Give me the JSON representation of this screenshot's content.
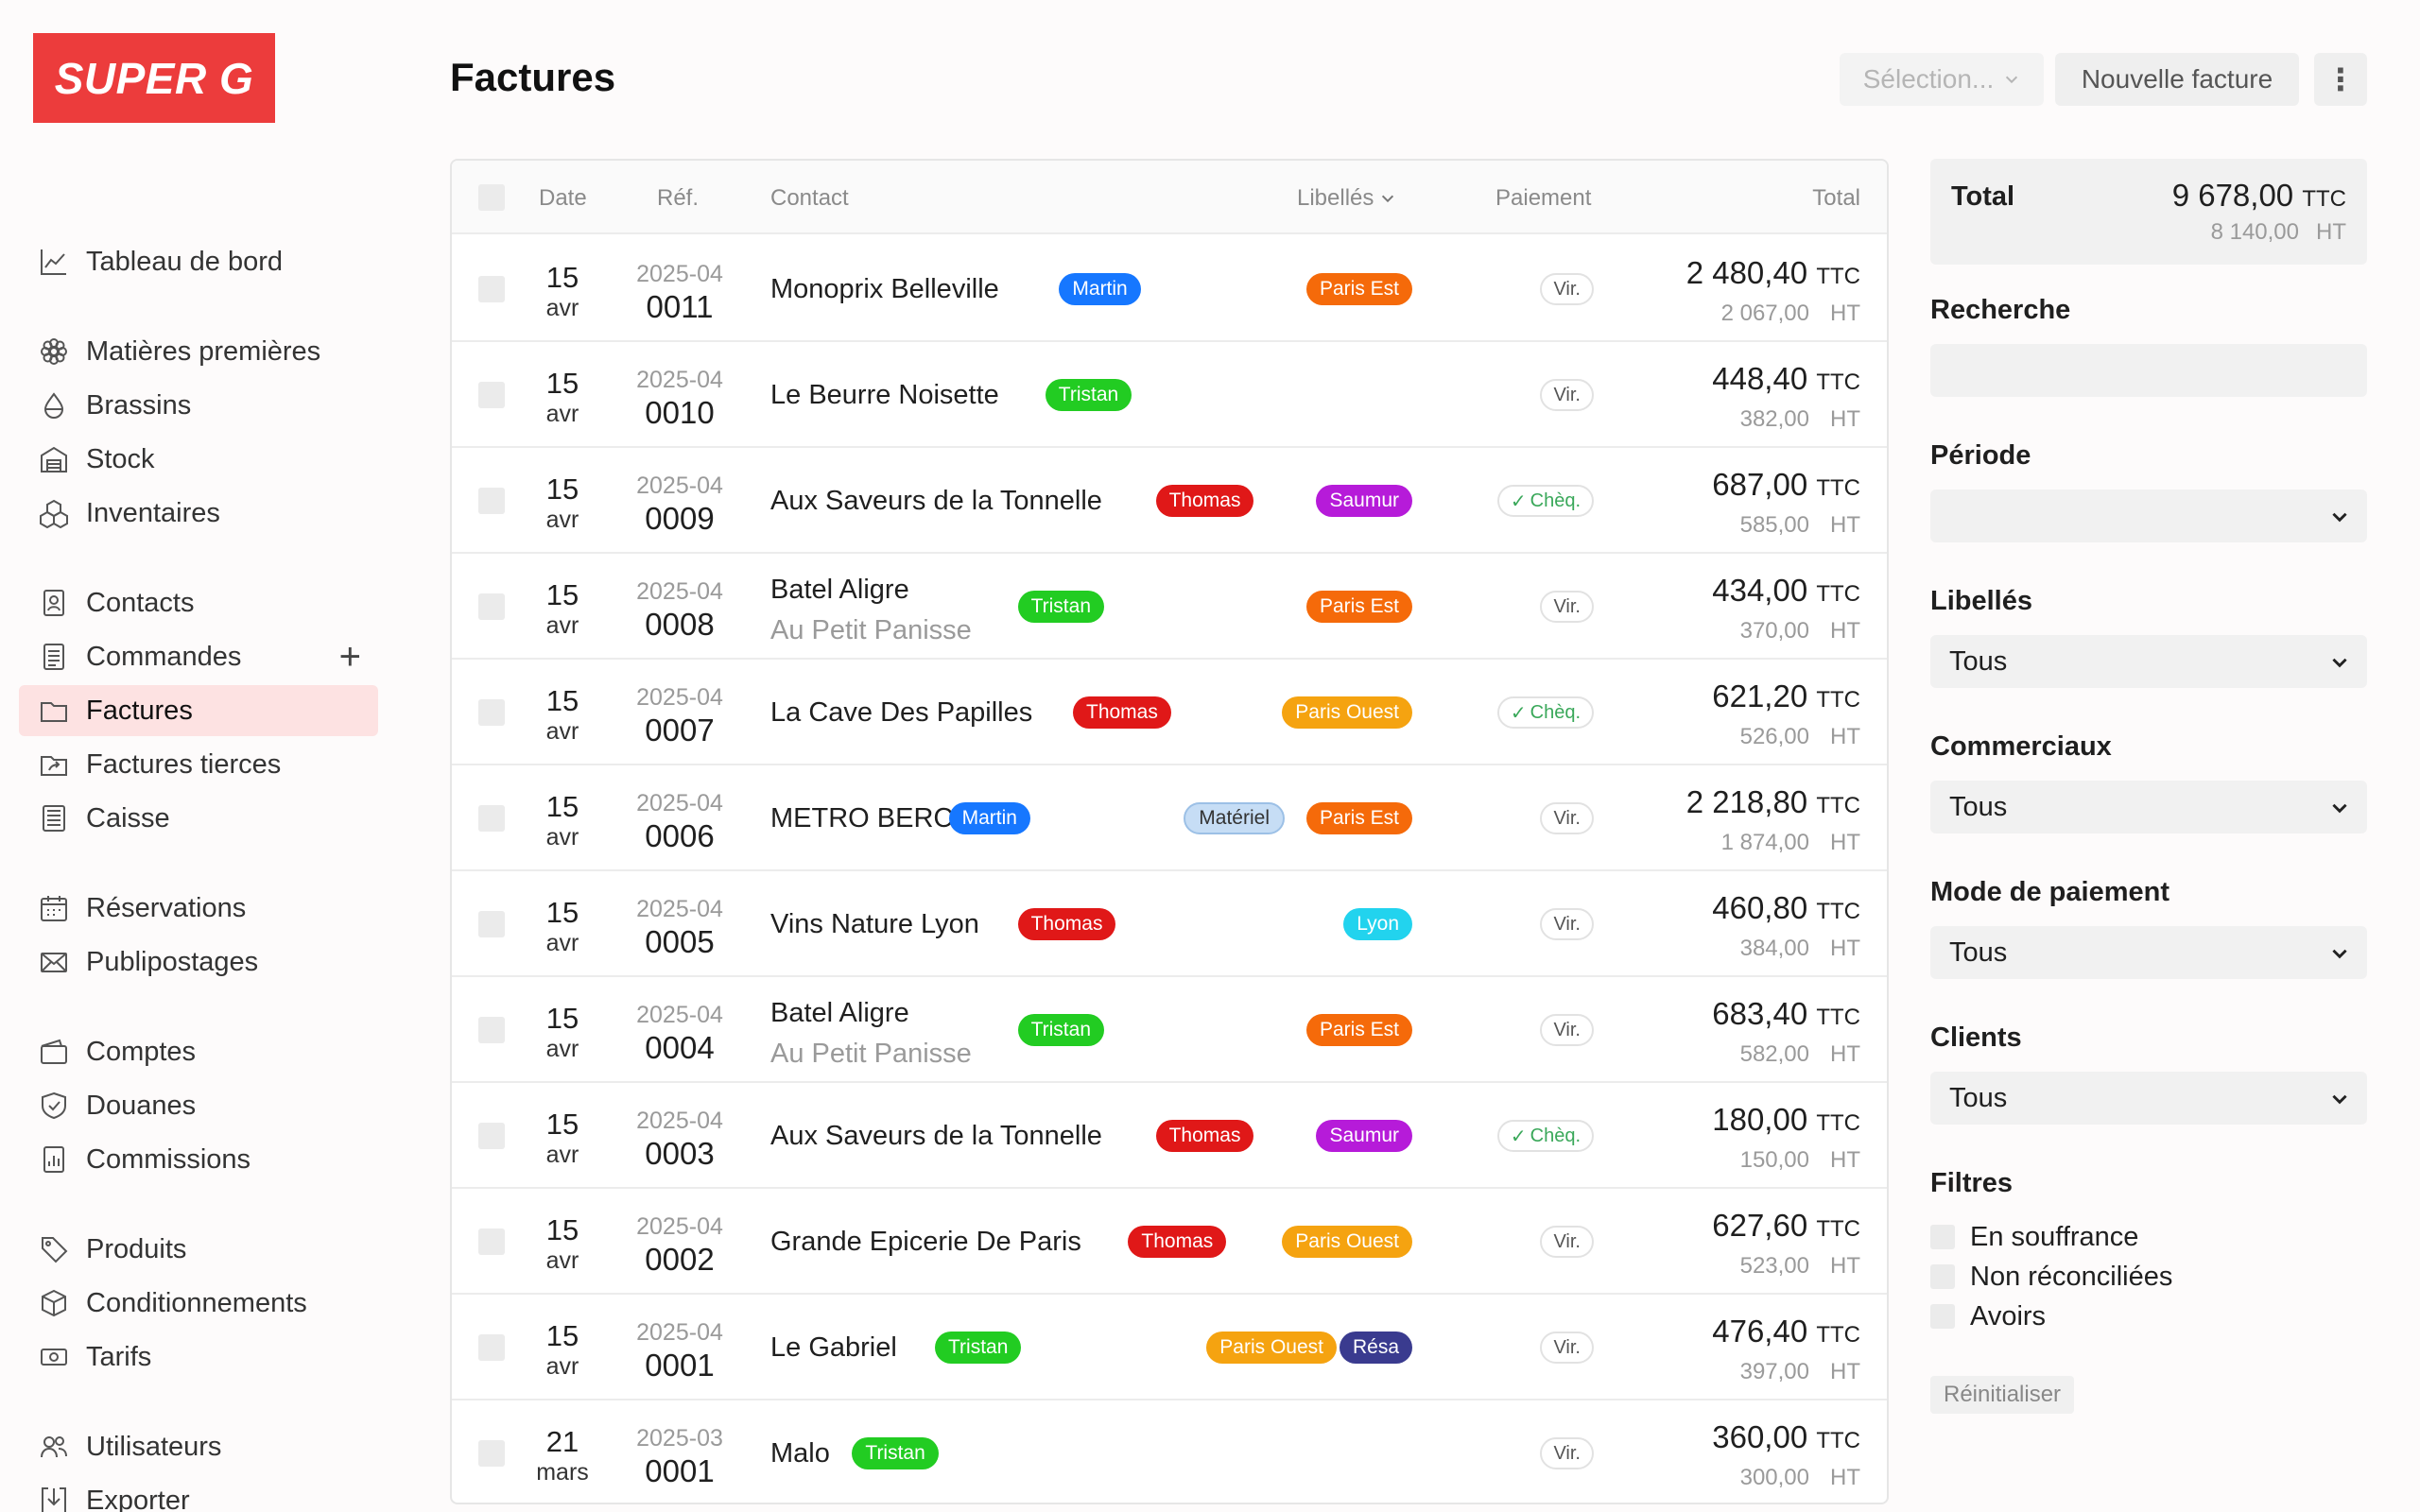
{
  "brand": {
    "logo_text": "SUPER G",
    "color": "#ec3c3c"
  },
  "sidebar": {
    "items": [
      {
        "label": "Tableau de bord",
        "icon": "chart-line-icon"
      },
      {
        "label": "Matières premières",
        "icon": "flower-icon"
      },
      {
        "label": "Brassins",
        "icon": "drop-icon"
      },
      {
        "label": "Stock",
        "icon": "warehouse-icon"
      },
      {
        "label": "Inventaires",
        "icon": "boxes-icon"
      },
      {
        "label": "Contacts",
        "icon": "contact-card-icon"
      },
      {
        "label": "Commandes",
        "icon": "receipt-list-icon"
      },
      {
        "label": "Factures",
        "icon": "folder-icon",
        "active": true
      },
      {
        "label": "Factures tierces",
        "icon": "folder-share-icon"
      },
      {
        "label": "Caisse",
        "icon": "register-icon"
      },
      {
        "label": "Réservations",
        "icon": "calendar-icon"
      },
      {
        "label": "Publipostages",
        "icon": "envelope-icon"
      },
      {
        "label": "Comptes",
        "icon": "wallet-icon"
      },
      {
        "label": "Douanes",
        "icon": "shield-check-icon"
      },
      {
        "label": "Commissions",
        "icon": "bar-report-icon"
      },
      {
        "label": "Produits",
        "icon": "tag-icon"
      },
      {
        "label": "Conditionnements",
        "icon": "package-icon"
      },
      {
        "label": "Tarifs",
        "icon": "banknote-icon"
      },
      {
        "label": "Utilisateurs",
        "icon": "users-icon"
      },
      {
        "label": "Exporter",
        "icon": "download-box-icon"
      }
    ],
    "add_symbol": "+"
  },
  "header": {
    "title": "Factures",
    "selection_label": "Sélection...",
    "new_invoice_label": "Nouvelle facture",
    "more_symbol": "⋮"
  },
  "table": {
    "columns": {
      "date": "Date",
      "ref": "Réf.",
      "contact": "Contact",
      "labels": "Libellés",
      "payment": "Paiement",
      "total": "Total"
    },
    "unit_ttc": "TTC",
    "unit_ht": "HT",
    "rows": [
      {
        "day": "15",
        "month": "avr",
        "ref_year": "2025-04",
        "ref_num": "0011",
        "contact": "Monoprix Belleville",
        "contact2": "",
        "seller": "Martin",
        "labels": [
          "Paris Est"
        ],
        "payment": "Vir.",
        "cheq": false,
        "ttc": "2 480,40",
        "ht": "2 067,00"
      },
      {
        "day": "15",
        "month": "avr",
        "ref_year": "2025-04",
        "ref_num": "0010",
        "contact": "Le Beurre Noisette",
        "contact2": "",
        "seller": "Tristan",
        "labels": [],
        "payment": "Vir.",
        "cheq": false,
        "ttc": "448,40",
        "ht": "382,00"
      },
      {
        "day": "15",
        "month": "avr",
        "ref_year": "2025-04",
        "ref_num": "0009",
        "contact": "Aux Saveurs de la Tonnelle",
        "contact2": "",
        "seller": "Thomas",
        "labels": [
          "Saumur"
        ],
        "payment": "Chèq.",
        "cheq": true,
        "ttc": "687,00",
        "ht": "585,00"
      },
      {
        "day": "15",
        "month": "avr",
        "ref_year": "2025-04",
        "ref_num": "0008",
        "contact": "Batel Aligre",
        "contact2": "Au Petit Panisse",
        "seller": "Tristan",
        "labels": [
          "Paris Est"
        ],
        "payment": "Vir.",
        "cheq": false,
        "ttc": "434,00",
        "ht": "370,00"
      },
      {
        "day": "15",
        "month": "avr",
        "ref_year": "2025-04",
        "ref_num": "0007",
        "contact": "La Cave Des Papilles",
        "contact2": "",
        "seller": "Thomas",
        "labels": [
          "Paris Ouest"
        ],
        "payment": "Chèq.",
        "cheq": true,
        "ttc": "621,20",
        "ht": "526,00"
      },
      {
        "day": "15",
        "month": "avr",
        "ref_year": "2025-04",
        "ref_num": "0006",
        "contact": "METRO BERCY",
        "contact2": "",
        "seller": "Martin",
        "labels": [
          "Matériel",
          "Paris Est"
        ],
        "payment": "Vir.",
        "cheq": false,
        "ttc": "2 218,80",
        "ht": "1 874,00"
      },
      {
        "day": "15",
        "month": "avr",
        "ref_year": "2025-04",
        "ref_num": "0005",
        "contact": "Vins Nature Lyon",
        "contact2": "",
        "seller": "Thomas",
        "labels": [
          "Lyon"
        ],
        "payment": "Vir.",
        "cheq": false,
        "ttc": "460,80",
        "ht": "384,00"
      },
      {
        "day": "15",
        "month": "avr",
        "ref_year": "2025-04",
        "ref_num": "0004",
        "contact": "Batel Aligre",
        "contact2": "Au Petit Panisse",
        "seller": "Tristan",
        "labels": [
          "Paris Est"
        ],
        "payment": "Vir.",
        "cheq": false,
        "ttc": "683,40",
        "ht": "582,00"
      },
      {
        "day": "15",
        "month": "avr",
        "ref_year": "2025-04",
        "ref_num": "0003",
        "contact": "Aux Saveurs de la Tonnelle",
        "contact2": "",
        "seller": "Thomas",
        "labels": [
          "Saumur"
        ],
        "payment": "Chèq.",
        "cheq": true,
        "ttc": "180,00",
        "ht": "150,00"
      },
      {
        "day": "15",
        "month": "avr",
        "ref_year": "2025-04",
        "ref_num": "0002",
        "contact": "Grande Epicerie De Paris",
        "contact2": "",
        "seller": "Thomas",
        "labels": [
          "Paris Ouest"
        ],
        "payment": "Vir.",
        "cheq": false,
        "ttc": "627,60",
        "ht": "523,00"
      },
      {
        "day": "15",
        "month": "avr",
        "ref_year": "2025-04",
        "ref_num": "0001",
        "contact": "Le Gabriel",
        "contact2": "",
        "seller": "Tristan",
        "labels": [
          "Paris Ouest",
          "Résa"
        ],
        "payment": "Vir.",
        "cheq": false,
        "ttc": "476,40",
        "ht": "397,00"
      },
      {
        "day": "21",
        "month": "mars",
        "ref_year": "2025-03",
        "ref_num": "0001",
        "contact": "Malo",
        "contact2": "",
        "seller": "Tristan",
        "labels": [],
        "payment": "Vir.",
        "cheq": false,
        "ttc": "360,00",
        "ht": "300,00"
      }
    ]
  },
  "colors": {
    "Martin": "#1677ff",
    "Tristan": "#22cc22",
    "Thomas": "#e01818",
    "Paris Est": "#f56a0a",
    "Paris Ouest": "#f5a310",
    "Saumur": "#b61bd9",
    "Matériel": "#c6ddf5",
    "Lyon": "#22d3ee",
    "Résa": "#3a3b8f"
  },
  "panel": {
    "total_label": "Total",
    "total_ttc": "9 678,00",
    "total_ht": "8 140,00",
    "search_label": "Recherche",
    "period_label": "Période",
    "labels_label": "Libellés",
    "labels_value": "Tous",
    "sales_label": "Commerciaux",
    "sales_value": "Tous",
    "payment_label": "Mode de paiement",
    "payment_value": "Tous",
    "clients_label": "Clients",
    "clients_value": "Tous",
    "filters_label": "Filtres",
    "filters": [
      "En souffrance",
      "Non réconciliées",
      "Avoirs"
    ],
    "reset_label": "Réinitialiser"
  }
}
